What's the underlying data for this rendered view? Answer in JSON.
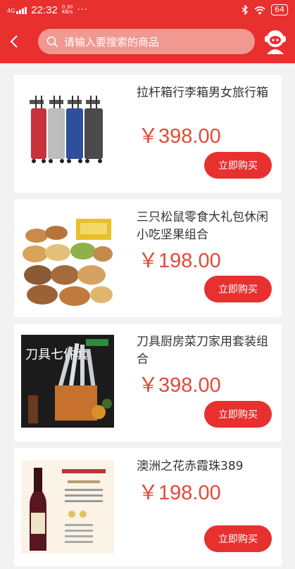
{
  "status": {
    "network": "4G",
    "time": "22:32",
    "speed_value": "0.30",
    "speed_unit": "KB/s",
    "more": "···",
    "battery": "64"
  },
  "header": {
    "search_placeholder": "请输入要搜索的商品"
  },
  "products": [
    {
      "title": "拉杆箱行李箱男女旅行箱",
      "price": "￥398.00",
      "buy_label": "立即购买"
    },
    {
      "title": "三只松鼠零食大礼包休闲小吃坚果组合",
      "price": "￥198.00",
      "buy_label": "立即购买"
    },
    {
      "title": "刀具厨房菜刀家用套装组合",
      "price": "￥398.00",
      "buy_label": "立即购买"
    },
    {
      "title": "澳洲之花赤霞珠389",
      "price": "￥198.00",
      "buy_label": "立即购买"
    }
  ],
  "image_text": {
    "knife_box": "刀具七件套"
  },
  "colors": {
    "brand": "#e8302f",
    "price": "#e14b38",
    "search_bg": "#f19890"
  }
}
